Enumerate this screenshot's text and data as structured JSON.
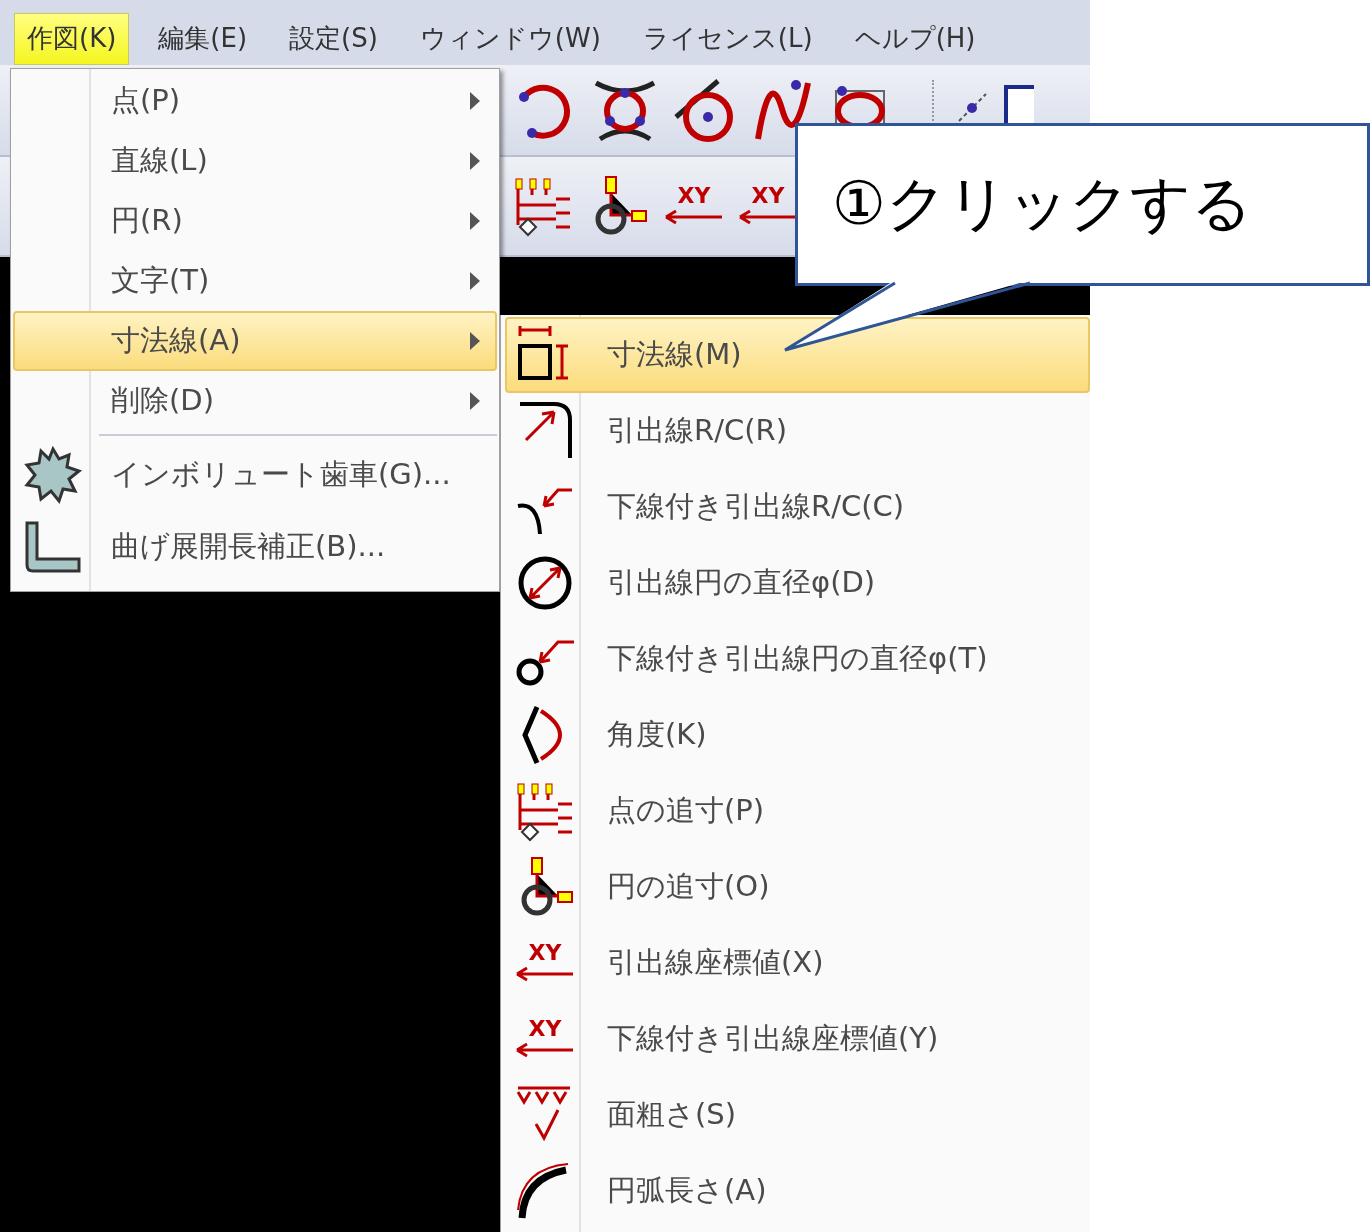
{
  "menubar": [
    {
      "label": "作図(K)",
      "selected": true
    },
    {
      "label": "編集(E)",
      "selected": false
    },
    {
      "label": "設定(S)",
      "selected": false
    },
    {
      "label": "ウィンドウ(W)",
      "selected": false
    },
    {
      "label": "ライセンス(L)",
      "selected": false
    },
    {
      "label": "ヘルプ(H)",
      "selected": false
    }
  ],
  "toolbar": {
    "xy_labels": [
      "XY",
      "XY"
    ]
  },
  "menu": {
    "items": [
      {
        "kind": "submenu",
        "label": "点(P)",
        "selected": false
      },
      {
        "kind": "submenu",
        "label": "直線(L)",
        "selected": false
      },
      {
        "kind": "submenu",
        "label": "円(R)",
        "selected": false
      },
      {
        "kind": "submenu",
        "label": "文字(T)",
        "selected": false
      },
      {
        "kind": "submenu",
        "label": "寸法線(A)",
        "selected": true
      },
      {
        "kind": "submenu",
        "label": "削除(D)",
        "selected": false
      },
      {
        "kind": "separator"
      },
      {
        "kind": "command",
        "label": "インボリュート歯車(G)...",
        "selected": false
      },
      {
        "kind": "command",
        "label": "曲げ展開長補正(B)...",
        "selected": false
      }
    ]
  },
  "submenu": {
    "items": [
      {
        "label": "寸法線(M)",
        "selected": true
      },
      {
        "label": "引出線R/C(R)",
        "selected": false
      },
      {
        "label": "下線付き引出線R/C(C)",
        "selected": false
      },
      {
        "label": "引出線円の直径φ(D)",
        "selected": false
      },
      {
        "label": "下線付き引出線円の直径φ(T)",
        "selected": false
      },
      {
        "label": "角度(K)",
        "selected": false
      },
      {
        "label": "点の追寸(P)",
        "selected": false
      },
      {
        "label": "円の追寸(O)",
        "selected": false
      },
      {
        "label": "引出線座標値(X)",
        "selected": false,
        "icon_text": "XY"
      },
      {
        "label": "下線付き引出線座標値(Y)",
        "selected": false,
        "icon_text": "XY"
      },
      {
        "label": "面粗さ(S)",
        "selected": false
      },
      {
        "label": "円弧長さ(A)",
        "selected": false
      }
    ]
  },
  "callout": {
    "text": "①クリックする"
  }
}
